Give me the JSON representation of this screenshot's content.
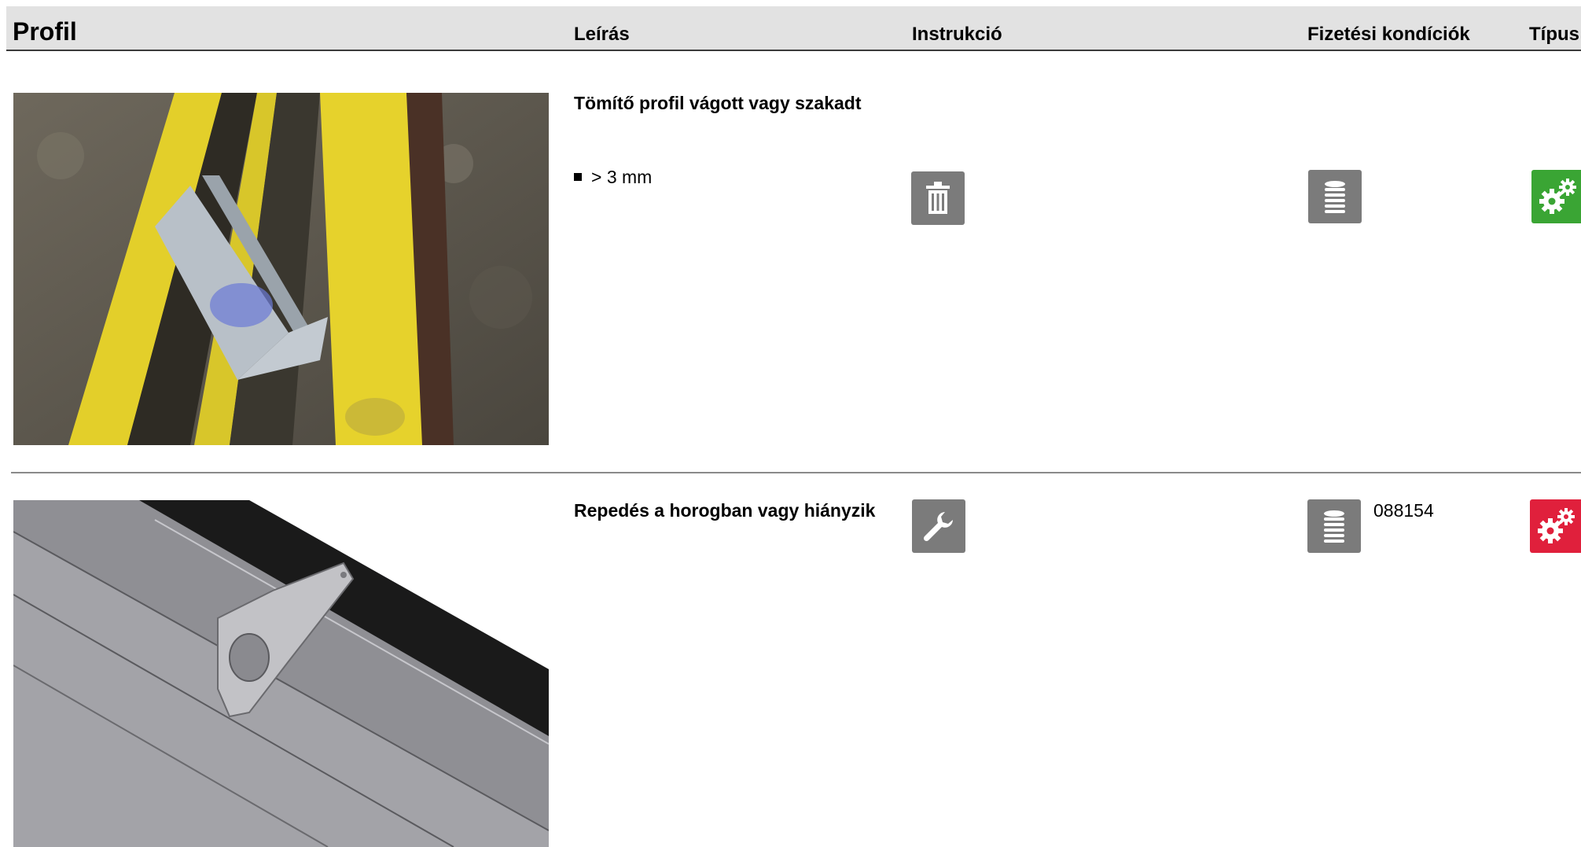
{
  "header": {
    "title": "Profil",
    "columns": {
      "description": "Leírás",
      "instruction": "Instrukció",
      "payment": "Fizetési kondíciók",
      "type": "Típus"
    }
  },
  "rows": [
    {
      "title": "Tömítő profil vágott vagy szakadt",
      "bullet": "> 3 mm",
      "instruction_icon": "trash-icon",
      "payment_icon": "coin-stack-icon",
      "payment_value": "",
      "type_icon": "gears-icon",
      "type_color": "#3aa534"
    },
    {
      "title": "Repedés a horogban vagy hiányzik",
      "bullet": "",
      "instruction_icon": "wrench-icon",
      "payment_icon": "coin-stack-icon",
      "payment_value": "088154",
      "type_icon": "gears-icon",
      "type_color": "#e0203c"
    }
  ]
}
